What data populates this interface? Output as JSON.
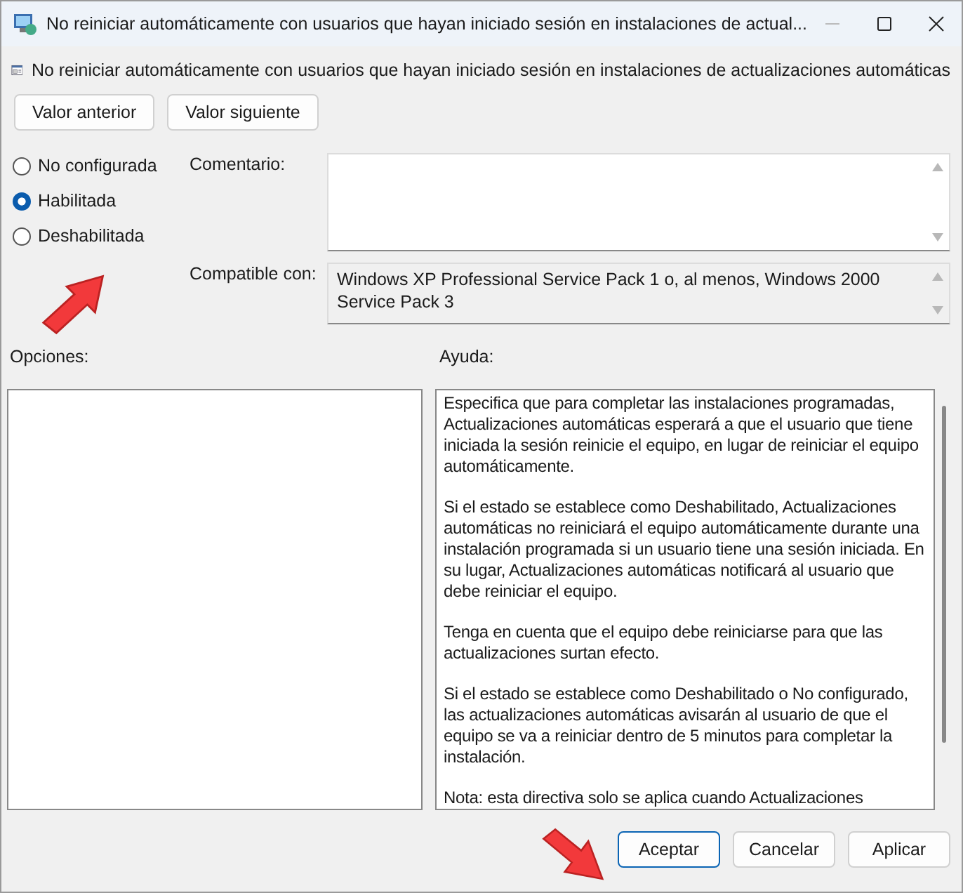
{
  "window": {
    "title": "No reiniciar automáticamente con usuarios que hayan iniciado sesión en instalaciones de actual..."
  },
  "policy_title": "No reiniciar automáticamente con usuarios que hayan iniciado sesión en instalaciones de actualizaciones automáticas",
  "nav_buttons": [
    "Valor anterior",
    "Valor siguiente"
  ],
  "state_options": [
    {
      "label": "No configurada",
      "selected": false
    },
    {
      "label": "Habilitada",
      "selected": true
    },
    {
      "label": "Deshabilitada",
      "selected": false
    }
  ],
  "comment": {
    "label": "Comentario:"
  },
  "supported_on": {
    "label": "Compatible con:",
    "value": "Windows XP Professional Service Pack 1 o, al menos, Windows 2000 Service Pack 3"
  },
  "options": {
    "label": "Opciones:"
  },
  "help": {
    "label": "Ayuda:",
    "paragraphs": [
      "Especifica que para completar las instalaciones programadas, Actualizaciones automáticas esperará a que el usuario que tiene iniciada la sesión reinicie el equipo, en lugar de reiniciar el equipo automáticamente.",
      "Si el estado se establece como Deshabilitado, Actualizaciones automáticas no reiniciará el equipo automáticamente durante una instalación programada si un usuario tiene una sesión iniciada. En su lugar, Actualizaciones automáticas notificará al usuario que debe reiniciar el equipo.",
      "Tenga en cuenta que el equipo debe reiniciarse para que las actualizaciones surtan efecto.",
      "Si el estado se establece como Deshabilitado o No configurado, las actualizaciones automáticas avisarán al usuario de que el equipo se va a reiniciar dentro de 5 minutos para completar la instalación.",
      "Nota: esta directiva solo se aplica cuando Actualizaciones"
    ]
  },
  "dialog_buttons": [
    {
      "label": "Aceptar",
      "kind": "default"
    },
    {
      "label": "Cancelar",
      "kind": "normal"
    },
    {
      "label": "Aplicar",
      "kind": "normal"
    }
  ]
}
